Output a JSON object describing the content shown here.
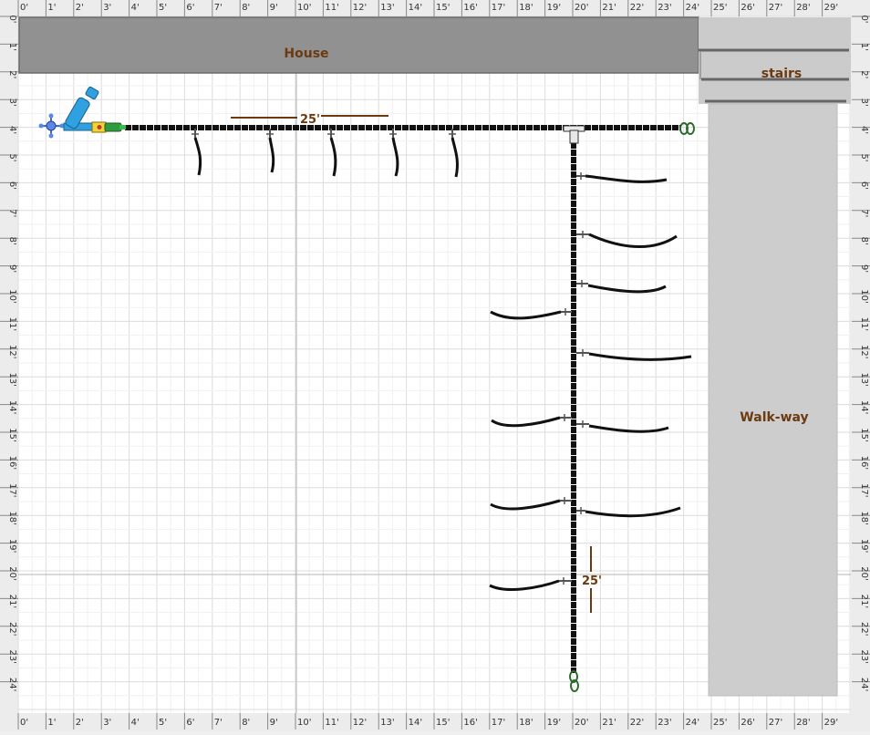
{
  "ruler": {
    "top_labels": [
      "0'",
      "1'",
      "2'",
      "3'",
      "4'",
      "5'",
      "6'",
      "7'",
      "8'",
      "9'",
      "10'",
      "11'",
      "12'",
      "13'",
      "14'",
      "15'",
      "16'",
      "17'",
      "18'",
      "19'",
      "20'",
      "21'",
      "22'",
      "23'",
      "24'",
      "25'",
      "26'",
      "27'",
      "28'",
      "29'"
    ],
    "side_labels": [
      "0'",
      "1'",
      "2'",
      "3'",
      "4'",
      "5'",
      "6'",
      "7'",
      "8'",
      "9'",
      "10'",
      "11'",
      "12'",
      "13'",
      "14'",
      "15'",
      "16'",
      "17'",
      "18'",
      "19'",
      "20'",
      "21'",
      "22'",
      "23'",
      "24'"
    ]
  },
  "areas": {
    "house": "House",
    "stairs": "stairs",
    "walkway": "Walk-way"
  },
  "dimensions": {
    "horizontal": "25'",
    "vertical": "25'"
  },
  "colors": {
    "label": "#6b3a10",
    "pipe": "#111111",
    "house": "#8e8e8e",
    "walkway": "#cfcfcf",
    "faucet": "#3a6fd8",
    "filter": "#2fa0e0"
  },
  "icons": [
    "faucet-icon",
    "filter-icon",
    "pressure-regulator-icon",
    "hose-adapter-icon",
    "tee-connector-icon",
    "end-cap-icon"
  ]
}
